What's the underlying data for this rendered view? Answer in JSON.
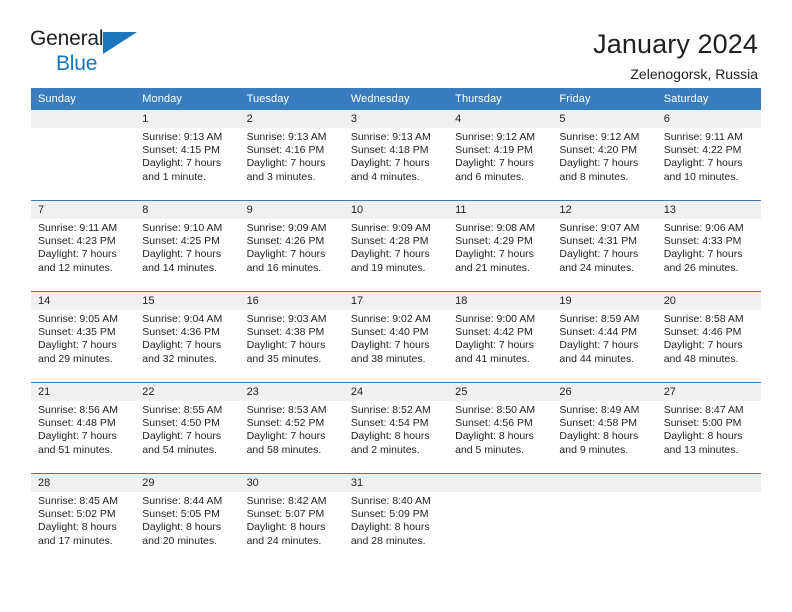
{
  "logo": {
    "primary_text": "General",
    "secondary_text": "Blue",
    "triangle_icon": "triangle-icon",
    "primary_color": "#231f20",
    "accent_color": "#1b75bb"
  },
  "header": {
    "month_title": "January 2024",
    "location": "Zelenogorsk, Russia"
  },
  "colors": {
    "header_row_bg": "#3a7dbf",
    "header_row_text": "#ffffff",
    "daynum_band_bg": "#f0f0f0",
    "text": "#231f20"
  },
  "weekday_headers": [
    "Sunday",
    "Monday",
    "Tuesday",
    "Wednesday",
    "Thursday",
    "Friday",
    "Saturday"
  ],
  "weeks": [
    [
      {
        "day": "",
        "sunrise": "",
        "sunset": "",
        "daylight_line1": "",
        "daylight_line2": ""
      },
      {
        "day": "1",
        "sunrise": "Sunrise: 9:13 AM",
        "sunset": "Sunset: 4:15 PM",
        "daylight_line1": "Daylight: 7 hours",
        "daylight_line2": "and 1 minute."
      },
      {
        "day": "2",
        "sunrise": "Sunrise: 9:13 AM",
        "sunset": "Sunset: 4:16 PM",
        "daylight_line1": "Daylight: 7 hours",
        "daylight_line2": "and 3 minutes."
      },
      {
        "day": "3",
        "sunrise": "Sunrise: 9:13 AM",
        "sunset": "Sunset: 4:18 PM",
        "daylight_line1": "Daylight: 7 hours",
        "daylight_line2": "and 4 minutes."
      },
      {
        "day": "4",
        "sunrise": "Sunrise: 9:12 AM",
        "sunset": "Sunset: 4:19 PM",
        "daylight_line1": "Daylight: 7 hours",
        "daylight_line2": "and 6 minutes."
      },
      {
        "day": "5",
        "sunrise": "Sunrise: 9:12 AM",
        "sunset": "Sunset: 4:20 PM",
        "daylight_line1": "Daylight: 7 hours",
        "daylight_line2": "and 8 minutes."
      },
      {
        "day": "6",
        "sunrise": "Sunrise: 9:11 AM",
        "sunset": "Sunset: 4:22 PM",
        "daylight_line1": "Daylight: 7 hours",
        "daylight_line2": "and 10 minutes."
      }
    ],
    [
      {
        "day": "7",
        "sunrise": "Sunrise: 9:11 AM",
        "sunset": "Sunset: 4:23 PM",
        "daylight_line1": "Daylight: 7 hours",
        "daylight_line2": "and 12 minutes."
      },
      {
        "day": "8",
        "sunrise": "Sunrise: 9:10 AM",
        "sunset": "Sunset: 4:25 PM",
        "daylight_line1": "Daylight: 7 hours",
        "daylight_line2": "and 14 minutes."
      },
      {
        "day": "9",
        "sunrise": "Sunrise: 9:09 AM",
        "sunset": "Sunset: 4:26 PM",
        "daylight_line1": "Daylight: 7 hours",
        "daylight_line2": "and 16 minutes."
      },
      {
        "day": "10",
        "sunrise": "Sunrise: 9:09 AM",
        "sunset": "Sunset: 4:28 PM",
        "daylight_line1": "Daylight: 7 hours",
        "daylight_line2": "and 19 minutes."
      },
      {
        "day": "11",
        "sunrise": "Sunrise: 9:08 AM",
        "sunset": "Sunset: 4:29 PM",
        "daylight_line1": "Daylight: 7 hours",
        "daylight_line2": "and 21 minutes."
      },
      {
        "day": "12",
        "sunrise": "Sunrise: 9:07 AM",
        "sunset": "Sunset: 4:31 PM",
        "daylight_line1": "Daylight: 7 hours",
        "daylight_line2": "and 24 minutes."
      },
      {
        "day": "13",
        "sunrise": "Sunrise: 9:06 AM",
        "sunset": "Sunset: 4:33 PM",
        "daylight_line1": "Daylight: 7 hours",
        "daylight_line2": "and 26 minutes."
      }
    ],
    [
      {
        "day": "14",
        "sunrise": "Sunrise: 9:05 AM",
        "sunset": "Sunset: 4:35 PM",
        "daylight_line1": "Daylight: 7 hours",
        "daylight_line2": "and 29 minutes."
      },
      {
        "day": "15",
        "sunrise": "Sunrise: 9:04 AM",
        "sunset": "Sunset: 4:36 PM",
        "daylight_line1": "Daylight: 7 hours",
        "daylight_line2": "and 32 minutes."
      },
      {
        "day": "16",
        "sunrise": "Sunrise: 9:03 AM",
        "sunset": "Sunset: 4:38 PM",
        "daylight_line1": "Daylight: 7 hours",
        "daylight_line2": "and 35 minutes."
      },
      {
        "day": "17",
        "sunrise": "Sunrise: 9:02 AM",
        "sunset": "Sunset: 4:40 PM",
        "daylight_line1": "Daylight: 7 hours",
        "daylight_line2": "and 38 minutes."
      },
      {
        "day": "18",
        "sunrise": "Sunrise: 9:00 AM",
        "sunset": "Sunset: 4:42 PM",
        "daylight_line1": "Daylight: 7 hours",
        "daylight_line2": "and 41 minutes."
      },
      {
        "day": "19",
        "sunrise": "Sunrise: 8:59 AM",
        "sunset": "Sunset: 4:44 PM",
        "daylight_line1": "Daylight: 7 hours",
        "daylight_line2": "and 44 minutes."
      },
      {
        "day": "20",
        "sunrise": "Sunrise: 8:58 AM",
        "sunset": "Sunset: 4:46 PM",
        "daylight_line1": "Daylight: 7 hours",
        "daylight_line2": "and 48 minutes."
      }
    ],
    [
      {
        "day": "21",
        "sunrise": "Sunrise: 8:56 AM",
        "sunset": "Sunset: 4:48 PM",
        "daylight_line1": "Daylight: 7 hours",
        "daylight_line2": "and 51 minutes."
      },
      {
        "day": "22",
        "sunrise": "Sunrise: 8:55 AM",
        "sunset": "Sunset: 4:50 PM",
        "daylight_line1": "Daylight: 7 hours",
        "daylight_line2": "and 54 minutes."
      },
      {
        "day": "23",
        "sunrise": "Sunrise: 8:53 AM",
        "sunset": "Sunset: 4:52 PM",
        "daylight_line1": "Daylight: 7 hours",
        "daylight_line2": "and 58 minutes."
      },
      {
        "day": "24",
        "sunrise": "Sunrise: 8:52 AM",
        "sunset": "Sunset: 4:54 PM",
        "daylight_line1": "Daylight: 8 hours",
        "daylight_line2": "and 2 minutes."
      },
      {
        "day": "25",
        "sunrise": "Sunrise: 8:50 AM",
        "sunset": "Sunset: 4:56 PM",
        "daylight_line1": "Daylight: 8 hours",
        "daylight_line2": "and 5 minutes."
      },
      {
        "day": "26",
        "sunrise": "Sunrise: 8:49 AM",
        "sunset": "Sunset: 4:58 PM",
        "daylight_line1": "Daylight: 8 hours",
        "daylight_line2": "and 9 minutes."
      },
      {
        "day": "27",
        "sunrise": "Sunrise: 8:47 AM",
        "sunset": "Sunset: 5:00 PM",
        "daylight_line1": "Daylight: 8 hours",
        "daylight_line2": "and 13 minutes."
      }
    ],
    [
      {
        "day": "28",
        "sunrise": "Sunrise: 8:45 AM",
        "sunset": "Sunset: 5:02 PM",
        "daylight_line1": "Daylight: 8 hours",
        "daylight_line2": "and 17 minutes."
      },
      {
        "day": "29",
        "sunrise": "Sunrise: 8:44 AM",
        "sunset": "Sunset: 5:05 PM",
        "daylight_line1": "Daylight: 8 hours",
        "daylight_line2": "and 20 minutes."
      },
      {
        "day": "30",
        "sunrise": "Sunrise: 8:42 AM",
        "sunset": "Sunset: 5:07 PM",
        "daylight_line1": "Daylight: 8 hours",
        "daylight_line2": "and 24 minutes."
      },
      {
        "day": "31",
        "sunrise": "Sunrise: 8:40 AM",
        "sunset": "Sunset: 5:09 PM",
        "daylight_line1": "Daylight: 8 hours",
        "daylight_line2": "and 28 minutes."
      },
      {
        "day": "",
        "sunrise": "",
        "sunset": "",
        "daylight_line1": "",
        "daylight_line2": ""
      },
      {
        "day": "",
        "sunrise": "",
        "sunset": "",
        "daylight_line1": "",
        "daylight_line2": ""
      },
      {
        "day": "",
        "sunrise": "",
        "sunset": "",
        "daylight_line1": "",
        "daylight_line2": ""
      }
    ]
  ]
}
